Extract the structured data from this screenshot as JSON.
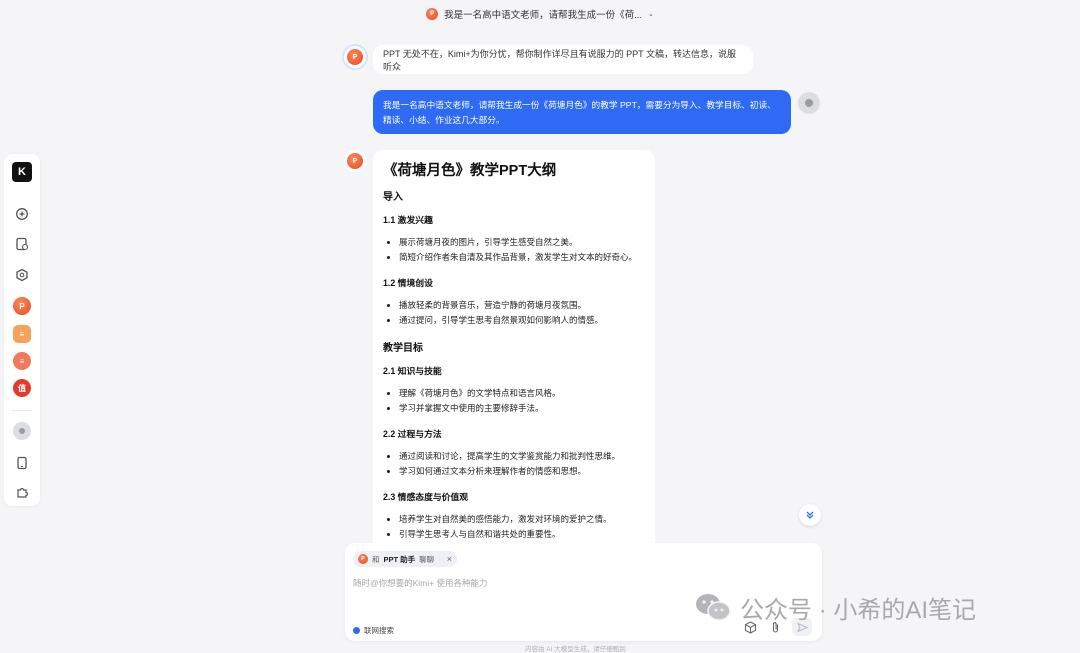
{
  "header": {
    "title": "我是一名高中语文老师，请帮我生成一份《荷..."
  },
  "sidebar": {
    "logo": "K"
  },
  "conversation": {
    "intro": "PPT 无处不在，Kimi+为你分忧，帮你制作详尽且有说服力的 PPT 文稿，转达信息，说服听众",
    "user_message": "我是一名高中语文老师，请帮我生成一份《荷塘月色》的教学 PPT，需要分为导入、教学目标、初读、精读、小结、作业这几大部分。",
    "answer": {
      "title": "《荷塘月色》教学PPT大纲",
      "sections": [
        {
          "heading": "导入"
        },
        {
          "heading": "教学目标"
        }
      ],
      "subsections": [
        {
          "heading": "1.1 激发兴趣",
          "items": [
            "展示荷塘月夜的图片，引导学生感受自然之美。",
            "简短介绍作者朱自清及其作品背景，激发学生对文本的好奇心。"
          ]
        },
        {
          "heading": "1.2 情境创设",
          "items": [
            "播放轻柔的背景音乐，营造宁静的荷塘月夜氛围。",
            "通过提问，引导学生思考自然景观如何影响人的情感。"
          ]
        },
        {
          "heading": "2.1 知识与技能",
          "items": [
            "理解《荷塘月色》的文学特点和语言风格。",
            "学习并掌握文中使用的主要修辞手法。"
          ]
        },
        {
          "heading": "2.2 过程与方法",
          "items": [
            "通过阅读和讨论，提高学生的文学鉴赏能力和批判性思维。",
            "学习如何通过文本分析来理解作者的情感和思想。"
          ]
        },
        {
          "heading": "2.3 情感态度与价值观",
          "items": [
            "培养学生对自然美的感悟能力，激发对环境的爱护之情。",
            "引导学生思考人与自然和谐共处的重要性。"
          ]
        }
      ]
    }
  },
  "composer": {
    "chip_prefix": "和",
    "chip_name": "PPT 助手",
    "chip_suffix": "聊聊",
    "chip_close": "×",
    "placeholder": "随时@你想要的Kimi+ 使用各种能力",
    "web_search_label": "联网搜索"
  },
  "footer_note": "内容由 AI 大模型生成，请仔细甄别",
  "watermark": "公众号 · 小希的AI笔记",
  "colors": {
    "accent": "#2e6af4",
    "ppt_icon": "#e6471f"
  }
}
